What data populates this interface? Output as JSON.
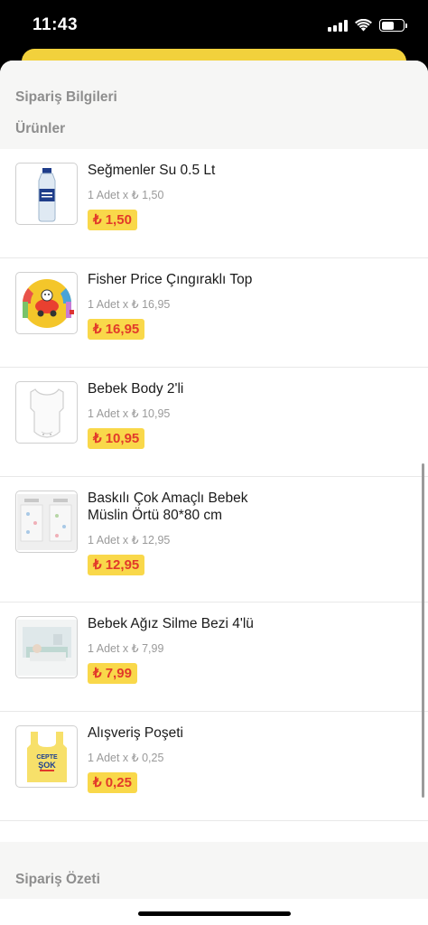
{
  "status_bar": {
    "time": "11:43",
    "battery_level": 0.6
  },
  "sections": {
    "order_info": "Sipariş Bilgileri",
    "products": "Ürünler",
    "order_summary": "Sipariş Özeti"
  },
  "products": [
    {
      "name": "Seğmenler Su 0.5 Lt",
      "qty": "1 Adet x ₺ 1,50",
      "price": "₺ 1,50",
      "icon": "water-bottle-image"
    },
    {
      "name": "Fisher Price Çıngıraklı Top",
      "qty": "1 Adet x ₺ 16,95",
      "price": "₺ 16,95",
      "icon": "rattle-ball-image"
    },
    {
      "name": "Bebek Body 2'li",
      "qty": "1 Adet x ₺ 10,95",
      "price": "₺ 10,95",
      "icon": "baby-body-image"
    },
    {
      "name": "Baskılı Çok Amaçlı Bebek Müslin Örtü 80*80 cm",
      "qty": "1 Adet x ₺ 12,95",
      "price": "₺ 12,95",
      "icon": "muslin-cloth-image"
    },
    {
      "name": "Bebek Ağız Silme Bezi 4'lü",
      "qty": "1 Adet x ₺ 7,99",
      "price": "₺ 7,99",
      "icon": "bib-cloth-image"
    },
    {
      "name": "Alışveriş Poşeti",
      "qty": "1 Adet x ₺ 0,25",
      "price": "₺ 0,25",
      "icon": "shopping-bag-image",
      "bag_text_1": "CEPTE",
      "bag_text_2": "ŞOK"
    }
  ],
  "colors": {
    "accent_yellow": "#f9d84a",
    "price_red": "#e23a2a",
    "muted_gray": "#8e8e8e"
  }
}
